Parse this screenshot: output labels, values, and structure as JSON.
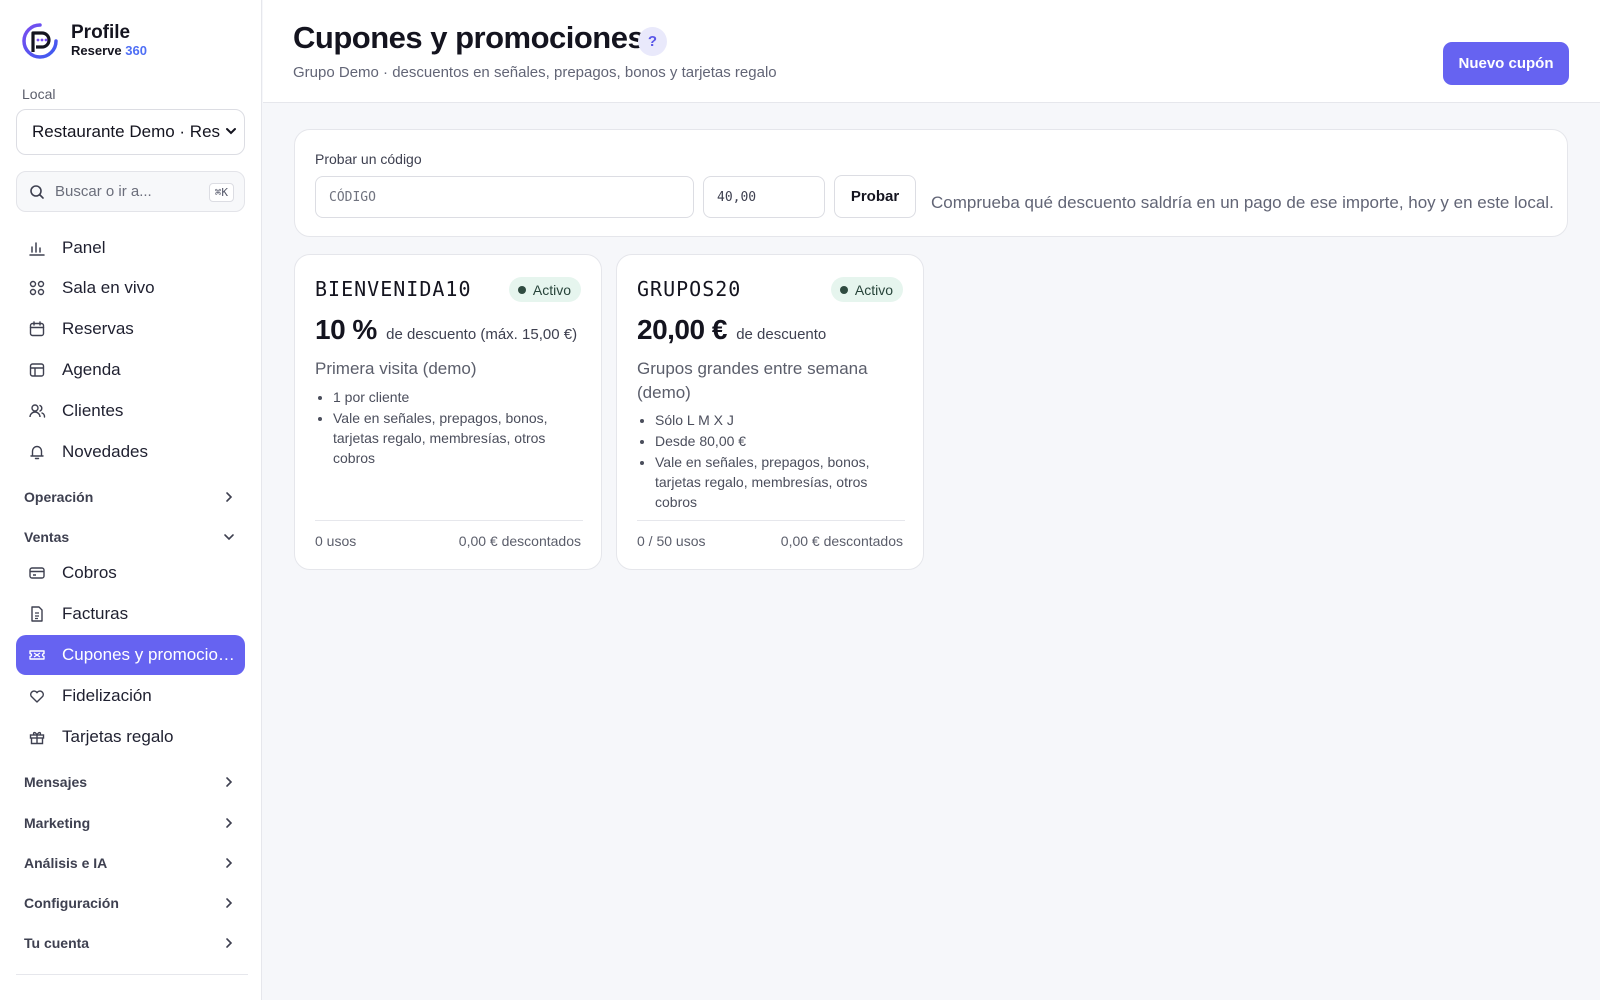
{
  "brand": {
    "name": "Profile",
    "sub_prefix": "Reserve",
    "sub_accent": "360",
    "accent_color": "#4f6ff5"
  },
  "sidebar": {
    "local_label": "Local",
    "local_value": "Restaurante Demo · Res",
    "search_placeholder": "Buscar o ir a...",
    "search_shortcut": "⌘K",
    "main_items": [
      {
        "label": "Panel",
        "icon": "chart-icon"
      },
      {
        "label": "Sala en vivo",
        "icon": "grid-icon"
      },
      {
        "label": "Reservas",
        "icon": "calendar-icon"
      },
      {
        "label": "Agenda",
        "icon": "table-icon"
      },
      {
        "label": "Clientes",
        "icon": "users-icon"
      },
      {
        "label": "Novedades",
        "icon": "bell-icon"
      }
    ],
    "sections": {
      "operacion": "Operación",
      "ventas": "Ventas",
      "mensajes": "Mensajes",
      "marketing": "Marketing",
      "analisis": "Análisis e IA",
      "configuracion": "Configuración",
      "cuenta": "Tu cuenta"
    },
    "ventas_items": [
      {
        "label": "Cobros",
        "icon": "card-icon"
      },
      {
        "label": "Facturas",
        "icon": "document-icon"
      },
      {
        "label": "Cupones y promociones",
        "icon": "ticket-icon",
        "active": true
      },
      {
        "label": "Fidelización",
        "icon": "heart-icon"
      },
      {
        "label": "Tarjetas regalo",
        "icon": "gift-icon"
      }
    ],
    "active_color": "#6663f1"
  },
  "header": {
    "title": "Cupones y promociones",
    "help": "?",
    "subtitle": "Grupo Demo · descuentos en señales, prepagos, bonos y tarjetas regalo",
    "new_button": "Nuevo cupón"
  },
  "tester": {
    "label": "Probar un código",
    "code_placeholder": "CÓDIGO",
    "amount_value": "40,00",
    "button": "Probar",
    "hint": "Comprueba qué descuento saldría en un pago de ese importe, hoy y en este local."
  },
  "coupons": [
    {
      "code": "BIENVENIDA10",
      "status": "Activo",
      "value": "10 %",
      "value_unit": "de descuento (máx. 15,00 €)",
      "description": "Primera visita (demo)",
      "conditions": [
        "1 por cliente",
        "Vale en señales, prepagos, bonos, tarjetas regalo, membresías, otros cobros"
      ],
      "uses": "0 usos",
      "discounted": "0,00 € descontados"
    },
    {
      "code": "GRUPOS20",
      "status": "Activo",
      "value": "20,00 €",
      "value_unit": "de descuento",
      "description": "Grupos grandes entre semana (demo)",
      "conditions": [
        "Sólo L M X J",
        "Desde 80,00 €",
        "Vale en señales, prepagos, bonos, tarjetas regalo, membresías, otros cobros"
      ],
      "uses": "0 / 50 usos",
      "discounted": "0,00 € descontados"
    }
  ],
  "status_color": "#e6f5ee"
}
